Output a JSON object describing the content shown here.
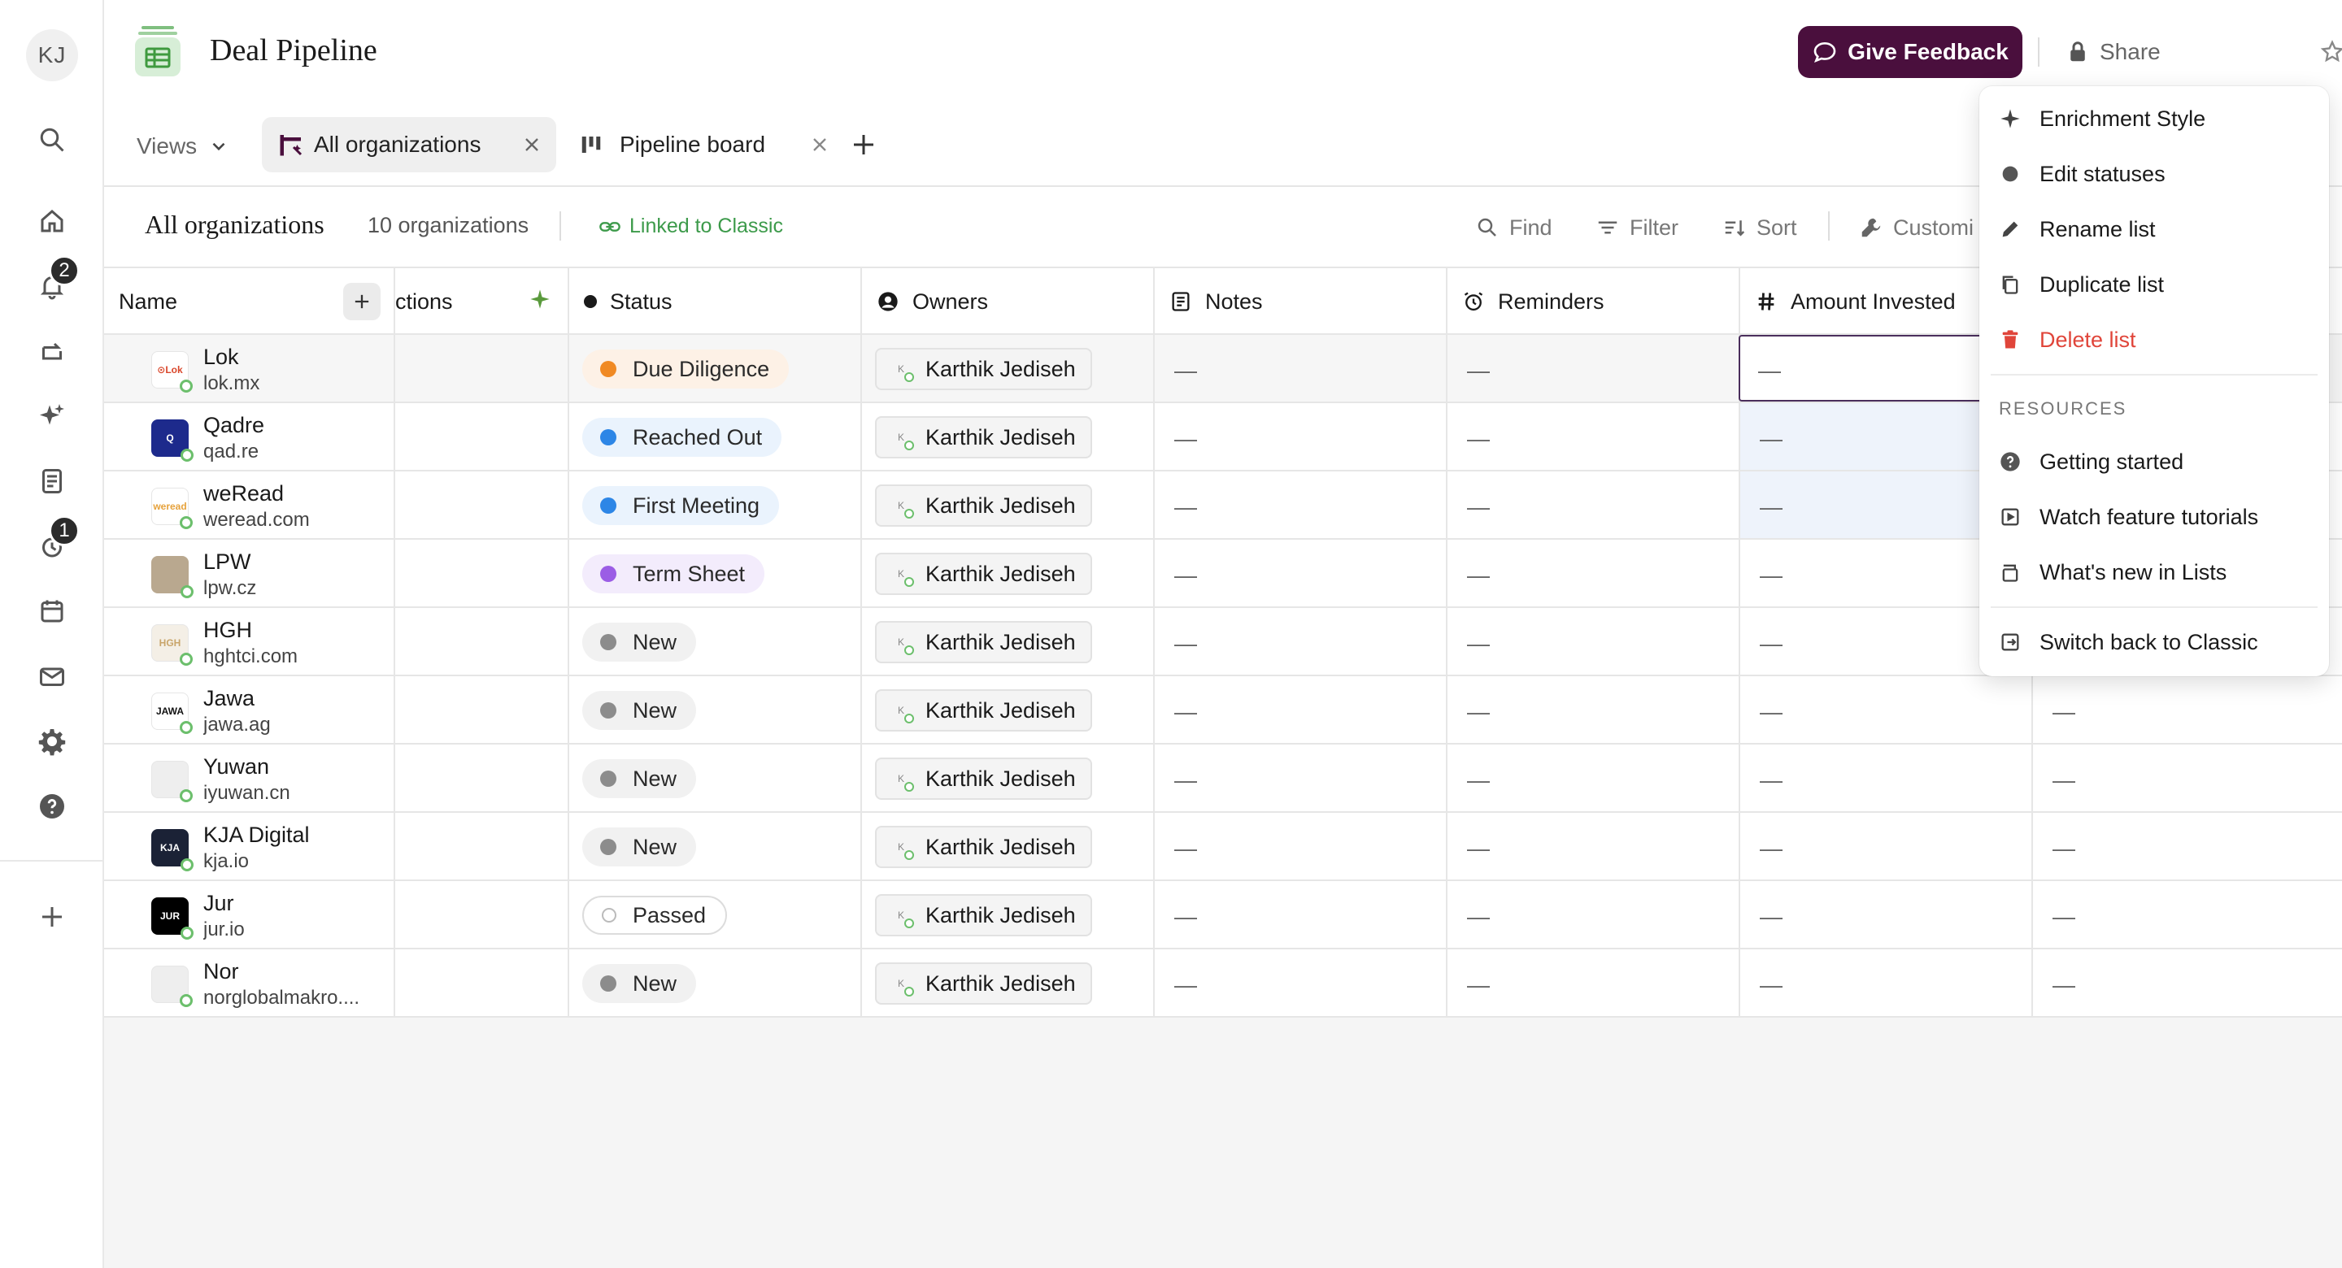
{
  "rail": {
    "avatar_initials": "KJ",
    "notifications_badge": "2",
    "reminders_badge": "1"
  },
  "header": {
    "title": "Deal Pipeline",
    "feedback_label": "Give Feedback",
    "share_label": "Share"
  },
  "views": {
    "dropdown_label": "Views",
    "tabs": [
      {
        "label": "All organizations",
        "active": true
      },
      {
        "label": "Pipeline board",
        "active": false
      }
    ]
  },
  "toolbar": {
    "list_title": "All organizations",
    "count": "10 organizations",
    "linked_label": "Linked to Classic",
    "find_label": "Find",
    "filter_label": "Filter",
    "sort_label": "Sort",
    "customize_label": "Customi"
  },
  "table": {
    "columns": {
      "name": "Name",
      "connections": "ctions",
      "status": "Status",
      "owners": "Owners",
      "notes": "Notes",
      "reminders": "Reminders",
      "amount": "Amount Invested"
    },
    "empty_value": "—",
    "rows": [
      {
        "name": "Lok",
        "domain": "lok.mx",
        "status": "Due Diligence",
        "status_color": "#f08a24",
        "owner": "Karthik Jediseh",
        "owner_initials": "K",
        "logo_text": "⊙Lok",
        "logo_bg": "#ffffff",
        "logo_color": "#d9472b"
      },
      {
        "name": "Qadre",
        "domain": "qad.re",
        "status": "Reached Out",
        "status_color": "#2d86e6",
        "owner": "Karthik Jediseh",
        "owner_initials": "K",
        "logo_text": "Q",
        "logo_bg": "#1d2a8c",
        "logo_color": "#ffffff"
      },
      {
        "name": "weRead",
        "domain": "weread.com",
        "status": "First Meeting",
        "status_color": "#2d86e6",
        "owner": "Karthik Jediseh",
        "owner_initials": "K",
        "logo_text": "weread",
        "logo_bg": "#ffffff",
        "logo_color": "#e6a23c"
      },
      {
        "name": "LPW",
        "domain": "lpw.cz",
        "status": "Term Sheet",
        "status_color": "#9b5de5",
        "owner": "Karthik Jediseh",
        "owner_initials": "K",
        "logo_text": "",
        "logo_bg": "#b9a88f",
        "logo_color": "#ffffff"
      },
      {
        "name": "HGH",
        "domain": "hghtci.com",
        "status": "New",
        "status_color": "#8c8c8c",
        "owner": "Karthik Jediseh",
        "owner_initials": "K",
        "logo_text": "HGH",
        "logo_bg": "#f4efe6",
        "logo_color": "#c9a56a"
      },
      {
        "name": "Jawa",
        "domain": "jawa.ag",
        "status": "New",
        "status_color": "#8c8c8c",
        "owner": "Karthik Jediseh",
        "owner_initials": "K",
        "logo_text": "JAWA",
        "logo_bg": "#ffffff",
        "logo_color": "#111111"
      },
      {
        "name": "Yuwan",
        "domain": "iyuwan.cn",
        "status": "New",
        "status_color": "#8c8c8c",
        "owner": "Karthik Jediseh",
        "owner_initials": "K",
        "logo_text": "",
        "logo_bg": "#eeeeee",
        "logo_color": "#888888"
      },
      {
        "name": "KJA Digital",
        "domain": "kja.io",
        "status": "New",
        "status_color": "#8c8c8c",
        "owner": "Karthik Jediseh",
        "owner_initials": "K",
        "logo_text": "KJA",
        "logo_bg": "#1b2236",
        "logo_color": "#ffffff"
      },
      {
        "name": "Jur",
        "domain": "jur.io",
        "status": "Passed",
        "status_color": "outline",
        "owner": "Karthik Jediseh",
        "owner_initials": "K",
        "logo_text": "JUR",
        "logo_bg": "#000000",
        "logo_color": "#ffffff"
      },
      {
        "name": "Nor",
        "domain": "norglobalmakro....",
        "status": "New",
        "status_color": "#8c8c8c",
        "owner": "Karthik Jediseh",
        "owner_initials": "K",
        "logo_text": "",
        "logo_bg": "#eeeeee",
        "logo_color": "#888888"
      }
    ]
  },
  "menu": {
    "items": [
      {
        "label": "Enrichment Style",
        "icon": "sparkle-icon"
      },
      {
        "label": "Edit statuses",
        "icon": "dot-icon"
      },
      {
        "label": "Rename list",
        "icon": "pencil-icon"
      },
      {
        "label": "Duplicate list",
        "icon": "copy-icon"
      },
      {
        "label": "Delete list",
        "icon": "trash-icon",
        "danger": true
      }
    ],
    "resources_header": "RESOURCES",
    "resources": [
      {
        "label": "Getting started",
        "icon": "help-icon"
      },
      {
        "label": "Watch feature tutorials",
        "icon": "video-icon"
      },
      {
        "label": "What's new in Lists",
        "icon": "gift-icon"
      }
    ],
    "switch_label": "Switch back to Classic"
  },
  "colors": {
    "accent": "#4a0f3d",
    "link_green": "#3c9a4a",
    "danger": "#e0453a"
  }
}
